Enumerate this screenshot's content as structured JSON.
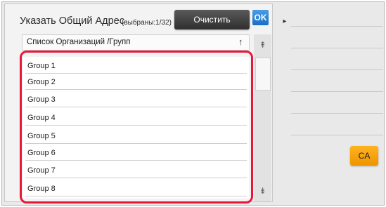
{
  "dialog": {
    "title": "Указать Общий Адрес",
    "selected_count": "(выбраны:1/32)",
    "clear_button": "Очистить",
    "ok_button": "OK"
  },
  "list": {
    "column_header": "Список Организаций /Групп",
    "sort_icon": "↑",
    "items": [
      "Group 1",
      "Group 2",
      "Group 3",
      "Group 4",
      "Group 5",
      "Group 6",
      "Group 7",
      "Group 8"
    ]
  },
  "scroll": {
    "top_icon": "⇞",
    "bottom_icon": "⇟"
  },
  "right_panel": {
    "collapse_icon": "▸",
    "ca_button": "CA"
  },
  "colors": {
    "highlight": "#e8173a",
    "ok_button": "#1a6fc4",
    "ca_button": "#ee9400"
  }
}
